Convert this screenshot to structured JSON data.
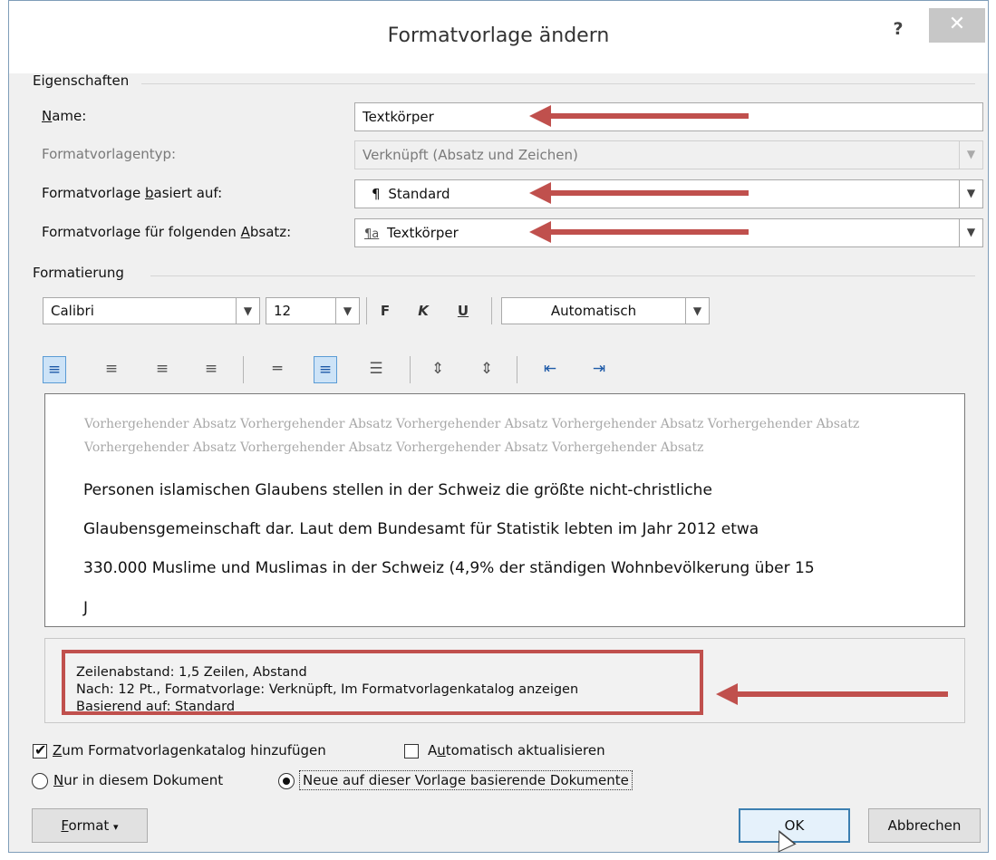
{
  "window": {
    "title": "Formatvorlage ändern",
    "help_icon": "?",
    "close_icon": "✕"
  },
  "eigenschaften": {
    "group_label": "Eigenschaften",
    "name": {
      "label_prefix": "",
      "label_u": "N",
      "label_rest": "ame:",
      "value": "Textkörper"
    },
    "typ": {
      "label": "Formatvorlagentyp:",
      "value": "Verknüpft (Absatz und Zeichen)"
    },
    "basiert": {
      "label_prefix": "Formatvorlage ",
      "label_u": "b",
      "label_rest": "asiert auf:",
      "icon": "¶",
      "value": "Standard"
    },
    "folgend": {
      "label_prefix": "Formatvorlage für folgenden ",
      "label_u": "A",
      "label_rest": "bsatz:",
      "icon": "¶a",
      "value": "Textkörper"
    }
  },
  "formatierung": {
    "group_label": "Formatierung",
    "font": "Calibri",
    "size": "12",
    "bold": "F",
    "italic": "K",
    "underline": "U",
    "color": "Automatisch"
  },
  "preview": {
    "previous_paragraph": "Vorhergehender Absatz Vorhergehender Absatz Vorhergehender Absatz Vorhergehender Absatz Vorhergehender Absatz Vorhergehender Absatz Vorhergehender Absatz Vorhergehender Absatz Vorhergehender Absatz",
    "line1": "Personen islamischen Glaubens stellen in der Schweiz die größte nicht-christliche",
    "line2": "Glaubensgemeinschaft dar. Laut dem Bundesamt für Statistik lebten im Jahr 2012 etwa",
    "line3": "330.000 Muslime und Muslimas in der Schweiz (4,9% der ständigen Wohnbevölkerung über 15",
    "line4": "J"
  },
  "description": {
    "line1": "Zeilenabstand:  1,5 Zeilen, Abstand",
    "line2": "Nach:  12 Pt., Formatvorlage: Verknüpft, Im Formatvorlagenkatalog anzeigen",
    "line3": "Basierend auf: Standard"
  },
  "options": {
    "add_gallery": {
      "label_u": "Z",
      "label_rest": "um Formatvorlagenkatalog hinzufügen",
      "checked": true
    },
    "auto_update": {
      "label_prefix": "A",
      "label_u": "u",
      "label_rest": "tomatisch aktualisieren",
      "checked": false
    },
    "only_doc": {
      "label_u": "N",
      "label_rest": "ur in diesem Dokument",
      "selected": false
    },
    "new_docs": {
      "label": "Neue auf dieser Vorlage basierende Dokumente",
      "selected": true
    }
  },
  "buttons": {
    "format_u": "F",
    "format_rest": "ormat",
    "format_arrow": "▾",
    "ok": "OK",
    "cancel": "Abbrechen"
  },
  "colors": {
    "annotation": "#c0504d",
    "selection": "#5a9bd5"
  }
}
